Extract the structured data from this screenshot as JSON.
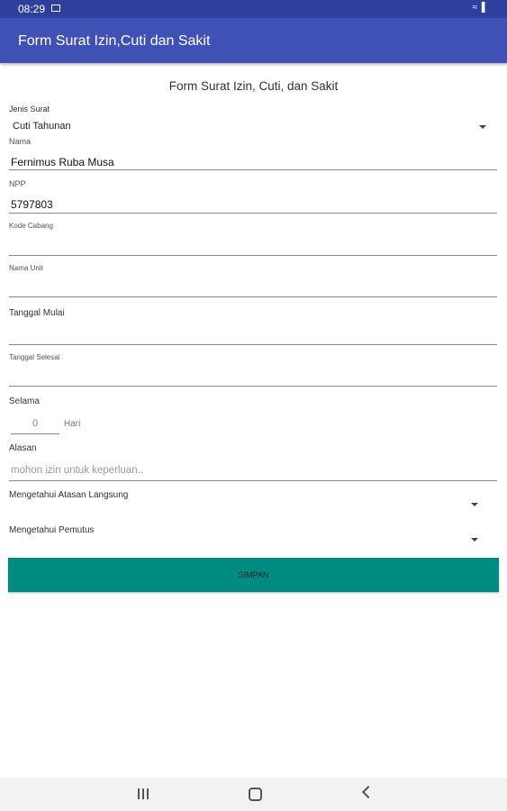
{
  "status_bar": {
    "time": "08:29",
    "right": "≈ ▌"
  },
  "app_bar": {
    "title": "Form Surat Izin,Cuti dan Sakit"
  },
  "form": {
    "header": "Form Surat Izin, Cuti, dan Sakit",
    "jenis_surat": {
      "label": "Jenis Surat",
      "value": "Cuti Tahunan"
    },
    "nama": {
      "label": "Nama",
      "value": "Fernimus Ruba Musa"
    },
    "npp": {
      "label": "NPP",
      "value": "5797803"
    },
    "kode_cabang": {
      "label": "Kode Cabang",
      "value": ""
    },
    "nama_unit": {
      "label": "Nama Unit",
      "value": ""
    },
    "tanggal_mulai": {
      "label": "Tanggal Mulai",
      "value": ""
    },
    "tanggal_selesai": {
      "label": "Tanggal Selesai",
      "value": ""
    },
    "selama": {
      "label": "Selama",
      "value": "0",
      "unit": "Hari"
    },
    "alasan": {
      "label": "Alasan",
      "placeholder": "mohon izin untuk keperluan.."
    },
    "atasan": {
      "label": "Mengetahui Atasan Langsung",
      "value": ""
    },
    "pemutus": {
      "label": "Mengetahui Pemutus",
      "value": ""
    },
    "submit_label": "SIMPAN"
  },
  "colors": {
    "status_bar": "#2f3f9e",
    "app_bar": "#3f51b5",
    "button": "#008b80"
  },
  "icons": {
    "recents": "recents-icon",
    "home": "home-icon",
    "back": "back-icon",
    "dropdown": "dropdown-arrow-icon"
  }
}
